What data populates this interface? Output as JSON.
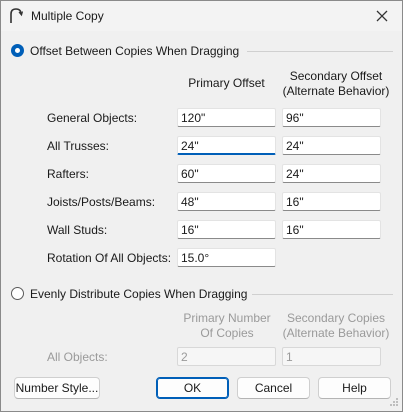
{
  "window": {
    "title": "Multiple Copy",
    "app_icon": "arc-tool-icon",
    "close_icon": "close-icon"
  },
  "offset_section": {
    "label": "Offset Between Copies When Dragging",
    "selected": true,
    "primary_header": "Primary Offset",
    "secondary_header_line1": "Secondary Offset",
    "secondary_header_line2": "(Alternate Behavior)",
    "rows": [
      {
        "label": "General Objects:",
        "primary": "120\"",
        "secondary": "96\""
      },
      {
        "label": "All Trusses:",
        "primary": "24\"",
        "secondary": "24\""
      },
      {
        "label": "Rafters:",
        "primary": "60\"",
        "secondary": "24\""
      },
      {
        "label": "Joists/Posts/Beams:",
        "primary": "48\"",
        "secondary": "16\""
      },
      {
        "label": "Wall Studs:",
        "primary": "16\"",
        "secondary": "16\""
      }
    ],
    "rotation_label": "Rotation Of All Objects:",
    "rotation_value": "15.0°"
  },
  "distribute_section": {
    "label": "Evenly Distribute Copies When Dragging",
    "selected": false,
    "primary_header_line1": "Primary Number",
    "primary_header_line2": "Of Copies",
    "secondary_header_line1": "Secondary Copies",
    "secondary_header_line2": "(Alternate Behavior)",
    "row_label": "All Objects:",
    "primary_value": "2",
    "secondary_value": "1"
  },
  "buttons": {
    "number_style": "Number Style...",
    "ok": "OK",
    "cancel": "Cancel",
    "help": "Help"
  }
}
